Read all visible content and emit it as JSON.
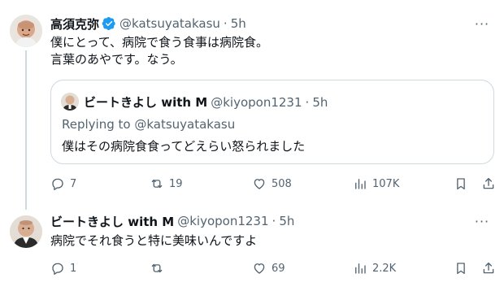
{
  "tweet1": {
    "display_name": "高須克弥",
    "handle": "@katsuyatakasu",
    "dot": "·",
    "time": "5h",
    "more": "···",
    "text": "僕にとって、病院で食う食事は病院食。\n言葉のあやです。なう。",
    "quote": {
      "display_name": "ビートきよし with M",
      "handle": "@kiyopon1231",
      "dot": "·",
      "time": "5h",
      "replying_to": "Replying to @katsuyatakasu",
      "text": "僕はその病院食食ってどえらい怒られました"
    },
    "actions": {
      "replies": "7",
      "retweets": "19",
      "likes": "508",
      "views": "107K"
    }
  },
  "tweet2": {
    "display_name": "ビートきよし with M",
    "handle": "@kiyopon1231",
    "dot": "·",
    "time": "5h",
    "more": "···",
    "text": "病院でそれ食うと特に美味いんですよ",
    "actions": {
      "replies": "1",
      "retweets": "",
      "likes": "69",
      "views": "2.2K"
    }
  },
  "colors": {
    "text_primary": "#0f1419",
    "text_secondary": "#536471",
    "border": "#cfd9de",
    "verified": "#1d9bf0"
  },
  "icons": [
    "verified-badge-icon",
    "more-icon",
    "reply-icon",
    "retweet-icon",
    "like-icon",
    "views-icon",
    "bookmark-icon",
    "share-icon"
  ]
}
